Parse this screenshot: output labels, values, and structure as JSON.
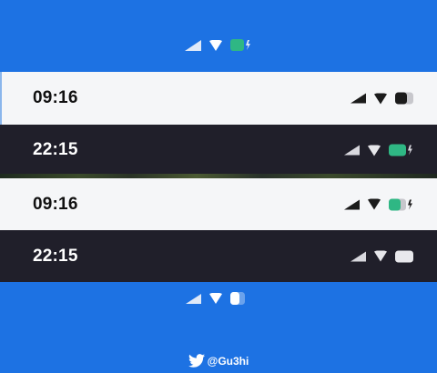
{
  "header_icons": {
    "signal": "signal-icon",
    "wifi": "wifi-icon",
    "battery": "battery-charging-icon",
    "battery_color": "#2fb784"
  },
  "bars": [
    {
      "theme": "light",
      "time": "09:16",
      "battery_state": "low",
      "battery_color": "#1b1b1b"
    },
    {
      "theme": "dark",
      "time": "22:15",
      "battery_state": "charging",
      "battery_color": "#2fb784"
    },
    {
      "theme": "light",
      "time": "09:16",
      "battery_state": "charging",
      "battery_color": "#2fb784"
    },
    {
      "theme": "dark",
      "time": "22:15",
      "battery_state": "full",
      "battery_color": "#e8e8ec"
    }
  ],
  "footer_icons": {
    "signal": "signal-icon",
    "wifi": "wifi-icon",
    "battery": "battery-icon"
  },
  "credit": {
    "icon": "twitter-bird-icon",
    "handle": "@Gu3hi"
  },
  "colors": {
    "background": "#1d72e3",
    "light_bar": "#f5f6f8",
    "dark_bar": "#201f2a",
    "accent_green": "#2fb784"
  }
}
